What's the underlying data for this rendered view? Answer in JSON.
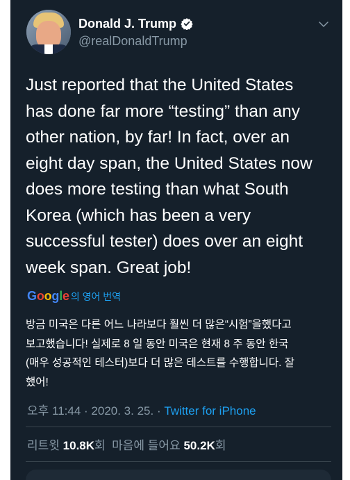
{
  "author": {
    "name": "Donald J. Trump",
    "handle": "@realDonaldTrump"
  },
  "tweet": {
    "text": "Just reported that the United States\nhas done far more “testing” than any\nother nation, by far! In fact, over an\neight day span, the United States now\ndoes more testing than what South\nKorea (which has been a very\nsuccessful tester) does over an eight\nweek span. Great job!"
  },
  "translate": {
    "logo_letters": [
      "G",
      "o",
      "o",
      "g",
      "l",
      "e"
    ],
    "logo_colors": [
      "#4285f4",
      "#ea4335",
      "#fbbc05",
      "#4285f4",
      "#34a853",
      "#ea4335"
    ],
    "label": "의 영어 번역"
  },
  "translation": {
    "text": "방금 미국은 다른 어느 나라보다 훨씬 더 많은“시험”을했다고\n보고했습니다! 실제로 8 일 동안 미국은 현재 8 주 동안 한국\n(매우 성공적인 테스터)보다 더 많은 테스트를 수행합니다. 잘\n했어!"
  },
  "meta": {
    "time": "오후 11:44",
    "separator": " · ",
    "date": "2020. 3. 25.",
    "source": "Twitter for iPhone"
  },
  "stats": {
    "retweets_label": "리트윗",
    "retweets_count": "10.8K",
    "retweets_unit": "회",
    "likes_label": "마음에 들어요",
    "likes_count": "50.2K",
    "likes_unit": "회"
  },
  "colors": {
    "background": "#15202b",
    "text": "#ffffff",
    "secondary": "#8899a6",
    "accent": "#1da1f2"
  }
}
